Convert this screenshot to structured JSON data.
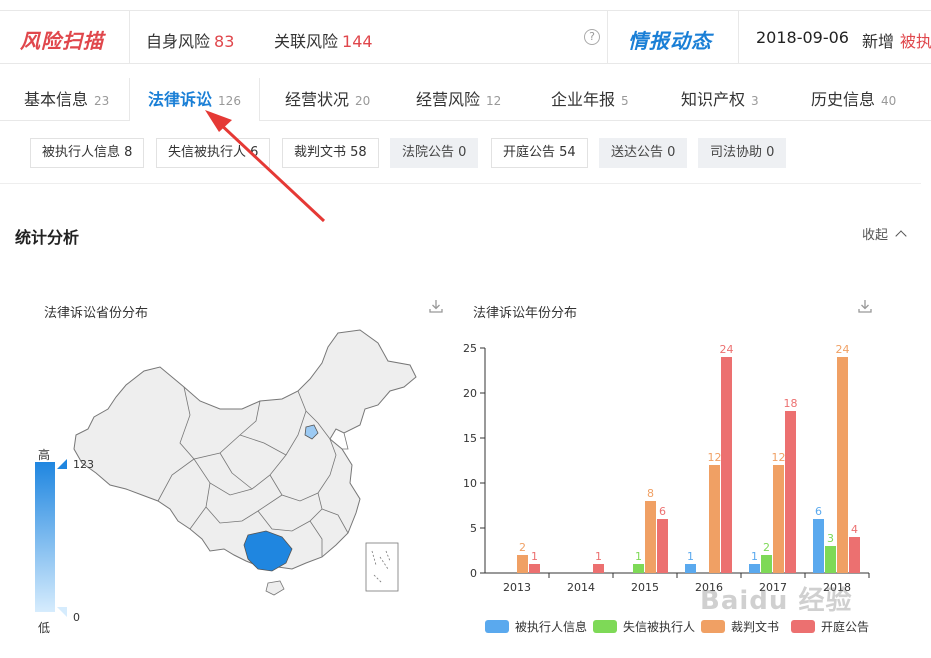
{
  "topbar": {
    "logo": "风险扫描",
    "self_risk_label": "自身风险",
    "self_risk_count": "83",
    "related_risk_label": "关联风险",
    "related_risk_count": "144",
    "help": "?",
    "news_title": "情报动态",
    "date": "2018-09-06",
    "new_label": "新增",
    "new_item": "被执"
  },
  "tabs": [
    {
      "label": "基本信息",
      "count": "23"
    },
    {
      "label": "法律诉讼",
      "count": "126"
    },
    {
      "label": "经营状况",
      "count": "20"
    },
    {
      "label": "经营风险",
      "count": "12"
    },
    {
      "label": "企业年报",
      "count": "5"
    },
    {
      "label": "知识产权",
      "count": "3"
    },
    {
      "label": "历史信息",
      "count": "40"
    }
  ],
  "filters": [
    {
      "label": "被执行人信息 8"
    },
    {
      "label": "失信被执行人 6"
    },
    {
      "label": "裁判文书 58"
    },
    {
      "label": "法院公告 0"
    },
    {
      "label": "开庭公告 54"
    },
    {
      "label": "送达公告 0"
    },
    {
      "label": "司法协助 0"
    }
  ],
  "section": {
    "title": "统计分析",
    "collapse": "收起"
  },
  "map_panel": {
    "title": "法律诉讼省份分布",
    "legend_high": "高",
    "legend_low": "低",
    "legend_max": "123",
    "legend_min": "0"
  },
  "chart_panel": {
    "title": "法律诉讼年份分布"
  },
  "colors": {
    "accent_blue": "#1a7fd6",
    "risk_red": "#e0474c",
    "series_blue": "#5aa9ee",
    "series_green": "#7ed957",
    "series_orange": "#f0a064",
    "series_red": "#ec7070"
  },
  "watermark": "Baidu 经验",
  "chart_data": {
    "type": "bar",
    "title": "法律诉讼年份分布",
    "categories": [
      "2013",
      "2014",
      "2015",
      "2016",
      "2017",
      "2018"
    ],
    "ylim": [
      0,
      25
    ],
    "yticks": [
      0,
      5,
      10,
      15,
      20,
      25
    ],
    "grid": false,
    "legend": "bottom",
    "series": [
      {
        "name": "被执行人信息",
        "color": "#5aa9ee",
        "values": [
          0,
          0,
          0,
          1,
          1,
          6
        ]
      },
      {
        "name": "失信被执行人",
        "color": "#7ed957",
        "values": [
          0,
          0,
          1,
          0,
          2,
          3
        ]
      },
      {
        "name": "裁判文书",
        "color": "#f0a064",
        "values": [
          2,
          0,
          8,
          12,
          12,
          24
        ]
      },
      {
        "name": "开庭公告",
        "color": "#ec7070",
        "values": [
          1,
          1,
          6,
          24,
          18,
          4
        ]
      }
    ]
  }
}
